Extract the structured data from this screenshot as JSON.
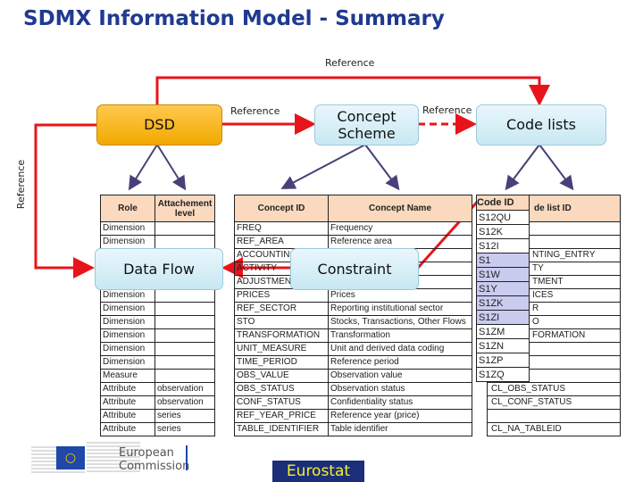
{
  "title": "SDMX Information Model - Summary",
  "labels": {
    "ref_top": "Reference",
    "ref_dsd_cs": "Reference",
    "ref_cs_cl": "Reference",
    "ref_left": "Reference"
  },
  "boxes": {
    "dsd": "DSD",
    "concept_scheme": "Concept Scheme",
    "code_lists": "Code lists",
    "data_flow": "Data Flow",
    "constraint": "Constraint"
  },
  "colors": {
    "arrow_red": "#e8141c",
    "arrow_purple": "#4a3f7a",
    "title": "#1f3a8f",
    "header_fill": "#fad9bf",
    "highlight": "#c9cbef"
  },
  "dsd_table": {
    "headers": [
      "Role",
      "Attachement level"
    ],
    "rows": [
      [
        "Dimension",
        ""
      ],
      [
        "Dimension",
        ""
      ],
      [
        "Dimension",
        ""
      ],
      [
        "Dimension",
        ""
      ],
      [
        "Dimension",
        ""
      ],
      [
        "Dimension",
        ""
      ],
      [
        "Dimension",
        ""
      ],
      [
        "Dimension",
        ""
      ],
      [
        "Dimension",
        ""
      ],
      [
        "Dimension",
        ""
      ],
      [
        "Dimension",
        ""
      ],
      [
        "Measure",
        ""
      ],
      [
        "Attribute",
        "observation"
      ],
      [
        "Attribute",
        "observation"
      ],
      [
        "Attribute",
        "series"
      ],
      [
        "Attribute",
        "series"
      ]
    ]
  },
  "concept_table": {
    "headers": [
      "Concept ID",
      "Concept Name"
    ],
    "rows": [
      [
        "FREQ",
        "Frequency"
      ],
      [
        "REF_AREA",
        "Reference area"
      ],
      [
        "ACCOUNTING",
        ""
      ],
      [
        "ACTIVITY",
        ""
      ],
      [
        "ADJUSTMENT",
        ""
      ],
      [
        "PRICES",
        "Prices"
      ],
      [
        "REF_SECTOR",
        "Reporting institutional sector"
      ],
      [
        "STO",
        "Stocks, Transactions, Other Flows"
      ],
      [
        "TRANSFORMATION",
        "Transformation"
      ],
      [
        "UNIT_MEASURE",
        "Unit and derived data coding"
      ],
      [
        "TIME_PERIOD",
        "Reference period"
      ],
      [
        "OBS_VALUE",
        "Observation value"
      ],
      [
        "OBS_STATUS",
        "Observation status"
      ],
      [
        "CONF_STATUS",
        "Confidentiality status"
      ],
      [
        "REF_YEAR_PRICE",
        "Reference year (price)"
      ],
      [
        "TABLE_IDENTIFIER",
        "Table identifier"
      ]
    ]
  },
  "codelist_table": {
    "header": "de list ID",
    "rows": [
      "",
      "",
      "NTING_ENTRY",
      "TY",
      "TMENT",
      "ICES",
      "R",
      "O",
      "FORMATION",
      "",
      "",
      "",
      "CL_OBS_STATUS",
      "CL_CONF_STATUS",
      "",
      "CL_NA_TABLEID"
    ]
  },
  "code_table": {
    "header": "Code ID",
    "codes": [
      {
        "v": "S12QU",
        "h": false
      },
      {
        "v": "S12K",
        "h": false
      },
      {
        "v": "S12I",
        "h": false
      },
      {
        "v": "S1",
        "h": true
      },
      {
        "v": "S1W",
        "h": true
      },
      {
        "v": "S1Y",
        "h": true
      },
      {
        "v": "S1ZK",
        "h": true
      },
      {
        "v": "S1ZI",
        "h": true
      },
      {
        "v": "S1ZM",
        "h": false
      },
      {
        "v": "S1ZN",
        "h": false
      },
      {
        "v": "S1ZP",
        "h": false
      },
      {
        "v": "S1ZQ",
        "h": false
      }
    ]
  },
  "footer": {
    "ec_line1": "European",
    "ec_line2": "Commission",
    "eurostat": "Eurostat"
  }
}
